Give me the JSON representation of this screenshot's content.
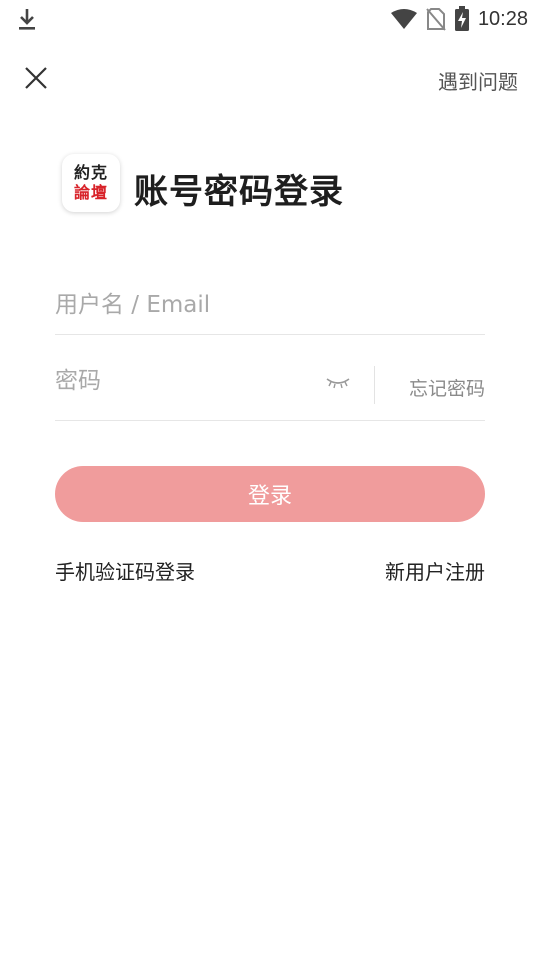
{
  "status_bar": {
    "time": "10:28",
    "icons": [
      "download-icon",
      "wifi-icon",
      "no-sim-icon",
      "battery-charging-icon"
    ]
  },
  "header": {
    "close_icon": "close-icon",
    "help_label": "遇到问题"
  },
  "brand": {
    "logo_top": "約克",
    "logo_bottom": "論壇",
    "logo_accent": "#d8232a"
  },
  "page": {
    "title": "账号密码登录"
  },
  "form": {
    "username_placeholder": "用户名 / Email",
    "username_value": "",
    "password_placeholder": "密码",
    "password_value": "",
    "eye_icon": "eye-closed-icon",
    "forgot_label": "忘记密码"
  },
  "actions": {
    "login_label": "登录",
    "login_color": "#f09c9c",
    "sms_login_label": "手机验证码登录",
    "register_label": "新用户注册"
  }
}
